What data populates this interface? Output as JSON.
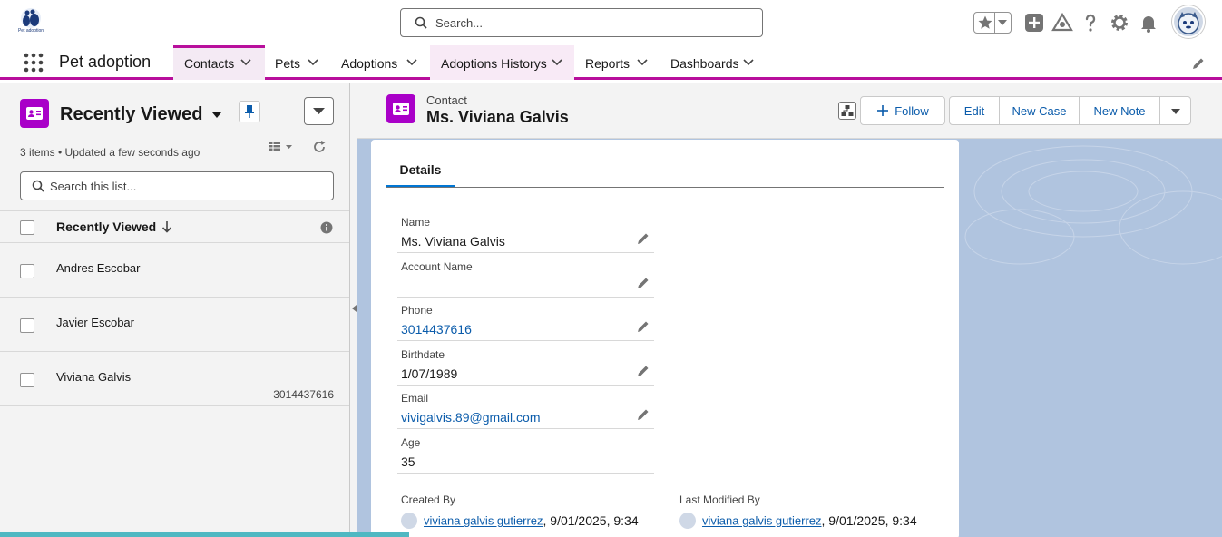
{
  "header": {
    "logo_text": "Pet adoption",
    "search_placeholder": "Search..."
  },
  "nav": {
    "app_name": "Pet adoption",
    "tabs": [
      {
        "label": "Contacts"
      },
      {
        "label": "Pets"
      },
      {
        "label": "Adoptions"
      },
      {
        "label": "Adoptions Historys"
      },
      {
        "label": "Reports"
      },
      {
        "label": "Dashboards"
      }
    ]
  },
  "list": {
    "title": "Recently Viewed",
    "meta": "3 items • Updated a few seconds ago",
    "search_placeholder": "Search this list...",
    "column_header": "Recently Viewed",
    "rows": [
      {
        "name": "Andres Escobar",
        "phone": ""
      },
      {
        "name": "Javier Escobar",
        "phone": ""
      },
      {
        "name": "Viviana Galvis",
        "phone": "3014437616"
      }
    ]
  },
  "record": {
    "type": "Contact",
    "name": "Ms. Viviana Galvis",
    "buttons": {
      "follow": "Follow",
      "edit": "Edit",
      "new_case": "New Case",
      "new_note": "New Note"
    },
    "tab": "Details",
    "fields": [
      {
        "label": "Name",
        "value": "Ms. Viviana Galvis"
      },
      {
        "label": "Account Name",
        "value": ""
      },
      {
        "label": "Phone",
        "value": "3014437616"
      },
      {
        "label": "Birthdate",
        "value": "1/07/1989"
      },
      {
        "label": "Email",
        "value": "vivigalvis.89@gmail.com"
      },
      {
        "label": "Age",
        "value": "35"
      }
    ],
    "created_by": {
      "label": "Created By",
      "user": "viviana galvis gutierrez",
      "date": ", 9/01/2025, 9:34"
    },
    "modified_by": {
      "label": "Last Modified By",
      "user": "viviana galvis gutierrez",
      "date": ", 9/01/2025, 9:34"
    }
  },
  "colors": {
    "brand": "#b80f9c",
    "contact_icon": "#a900c8",
    "link": "#0b5cab",
    "accent_tab": "#0176d3"
  }
}
